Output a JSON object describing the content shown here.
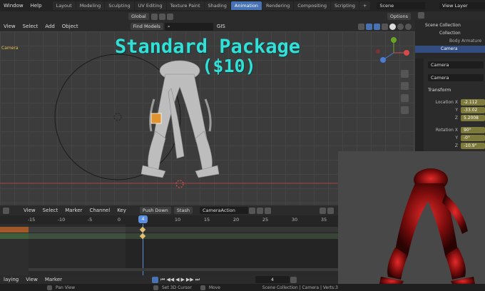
{
  "menubar": {
    "menus": [
      "Window",
      "Help"
    ],
    "workspaces": [
      "Layout",
      "Modeling",
      "Sculpting",
      "UV Editing",
      "Texture Paint",
      "Shading",
      "Animation",
      "Rendering",
      "Compositing",
      "Scripting"
    ],
    "active_workspace": "Animation",
    "scene_name": "Scene",
    "view_layer": "View Layer"
  },
  "viewport_header": {
    "menus": [
      "View",
      "Select",
      "Add",
      "Object"
    ],
    "orientation": "Global",
    "options_label": "Options",
    "find_models": "Find Models",
    "gis": "GIS",
    "camera_label": "Camera"
  },
  "promo": {
    "line1": "Standard Package",
    "line2": "($10)"
  },
  "outliner": {
    "items": [
      "Scene Collection",
      "Collection",
      "Body Armature",
      "Camera"
    ],
    "selected": "Camera"
  },
  "properties": {
    "object_name": "Camera",
    "data_name": "Camera",
    "section": "Transform",
    "location_label": "Location X",
    "location": [
      "-2.112",
      "-33.02",
      "5.2008"
    ],
    "rotation_label": "Rotation X",
    "rotation": [
      "90°",
      "-0°",
      "-10.9°"
    ],
    "axis_y": "Y",
    "axis_z": "Z"
  },
  "timeline": {
    "menus": [
      "View",
      "Select",
      "Marker",
      "Channel",
      "Key"
    ],
    "push_down": "Push Down",
    "stash": "Stash",
    "action": "CameraAction",
    "ticks": [
      "-15",
      "-10",
      "-5",
      "0",
      "4",
      "10",
      "15",
      "20",
      "25",
      "30",
      "35"
    ],
    "current_frame": "4",
    "playback_menus": [
      "laying",
      "View",
      "Marker"
    ]
  },
  "statusbar": {
    "items": [
      "Pan View",
      "Set 3D Cursor",
      "Move"
    ],
    "info": "Scene Collection | Camera | Verts:3"
  },
  "colors": {
    "accent": "#4772b3",
    "promo_text": "#33e0d7",
    "playhead": "#5b8fe0"
  }
}
